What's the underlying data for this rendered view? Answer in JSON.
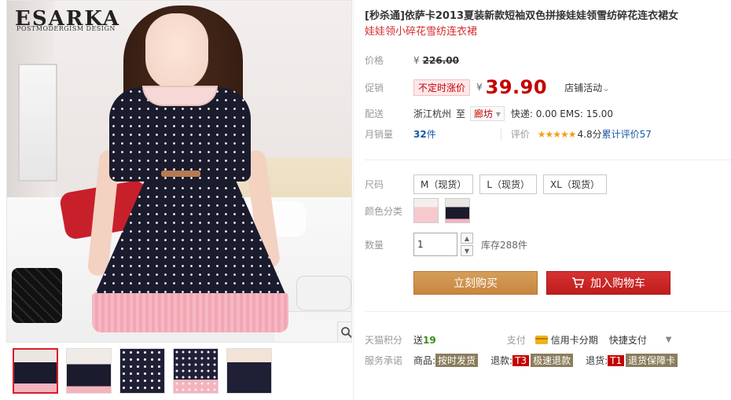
{
  "brand": {
    "logo": "ESARKA",
    "tagline": "POSTMODERGISM DESIGN"
  },
  "product": {
    "title": "[秒杀通]依萨卡2013夏装新款短袖双色拼接娃娃领雪纺碎花连衣裙女",
    "subtitle": "娃娃领小碎花雪纺连衣裙"
  },
  "price": {
    "label": "价格",
    "currency": "¥",
    "original": "226.00"
  },
  "promo": {
    "label": "促销",
    "tag": "不定时涨价",
    "currency": "¥",
    "price": "39.90",
    "shop_promo": "店铺活动",
    "shop_promo_chevron": "⌄"
  },
  "delivery": {
    "label": "配送",
    "origin": "浙江杭州",
    "to": "至",
    "destination": "廊坊",
    "destination_chevron": "▾",
    "shipping": "快递: 0.00 EMS: 15.00"
  },
  "sales": {
    "label": "月销量",
    "count": "32",
    "unit": "件",
    "review_label": "评价",
    "stars": "★★★★★",
    "score": "4.8分",
    "review_text": "累计评价57"
  },
  "options": {
    "size_label": "尺码",
    "sizes": [
      "M（现货）",
      "L（现货）",
      "XL（现货）"
    ],
    "color_label": "颜色分类",
    "qty_label": "数量",
    "qty_value": "1",
    "stock": "库存288件"
  },
  "buttons": {
    "buy_now": "立刻购买",
    "add_to_cart": "加入购物车"
  },
  "points": {
    "label": "天猫积分",
    "send": "送",
    "value": "19",
    "pay_label": "支付",
    "credit": "信用卡分期",
    "quick_pay": "快捷支付"
  },
  "service": {
    "label": "服务承诺",
    "goods_label": "商品:",
    "goods_tag": "按时发货",
    "return_label": "退款:",
    "return_prefix": "T3",
    "return_tag": "极速退款",
    "exchange_label": "退货:",
    "exchange_prefix": "T1",
    "exchange_tag": "退货保障卡"
  },
  "colors": {
    "price_red": "#c40000",
    "buy_brown": "#c7863f",
    "cart_red": "#d02727",
    "link_blue": "#1b57a8",
    "star_gold": "#f3a011"
  }
}
